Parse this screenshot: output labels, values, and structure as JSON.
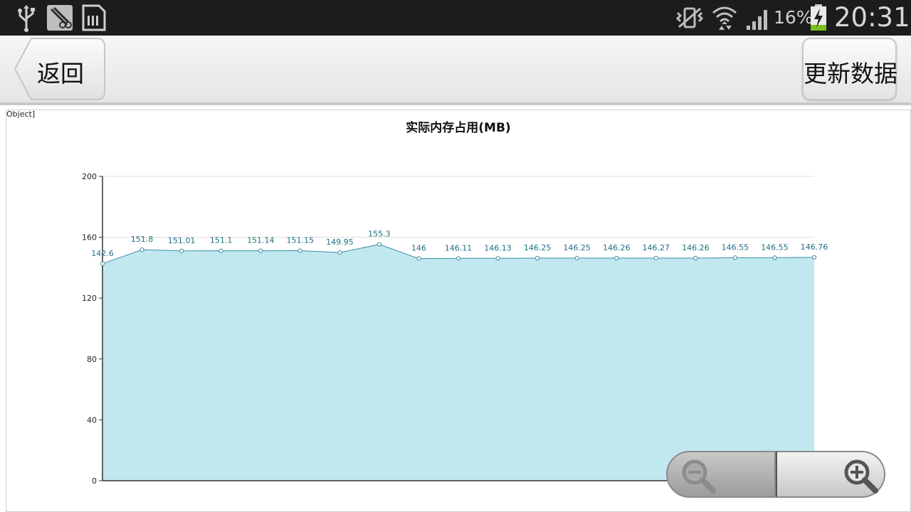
{
  "status_bar": {
    "battery_percent": "16%",
    "time": "20:31",
    "icons": [
      "usb-icon",
      "screenshot-app-icon",
      "sd-card-icon",
      "vibrate-icon",
      "wifi-icon",
      "signal-icon",
      "battery-charging-icon"
    ]
  },
  "action_bar": {
    "back_label": "返回",
    "update_label": "更新数据"
  },
  "chart_area": {
    "object_label": "Object]"
  },
  "chart_data": {
    "type": "area",
    "title": "实际内存占用(MB)",
    "xlabel": "",
    "ylabel": "",
    "ylim": [
      0,
      200
    ],
    "y_ticks": [
      "0",
      "40",
      "80",
      "120",
      "160",
      "200"
    ],
    "grid": "horizontal",
    "series": [
      {
        "values": [
          142.6,
          151.8,
          151.01,
          151.1,
          151.14,
          151.15,
          149.95,
          155.3,
          146,
          146.11,
          146.13,
          146.25,
          146.25,
          146.26,
          146.27,
          146.26,
          146.55,
          146.55,
          146.76
        ],
        "labels": [
          "142.6",
          "151.8",
          "151.01",
          "151.1",
          "151.14",
          "151.15",
          "149.95",
          "155.3",
          "146",
          "146.11",
          "146.13",
          "146.25",
          "146.25",
          "146.26",
          "146.27",
          "146.26",
          "146.55",
          "146.55",
          "146.76"
        ]
      }
    ],
    "colors": {
      "fill": "#c1e8ef",
      "line": "#3a8ea3",
      "grid": "#dcdcdc",
      "axis": "#333333"
    }
  },
  "zoom": {
    "out_icon": "zoom-out-icon",
    "in_icon": "zoom-in-icon"
  }
}
